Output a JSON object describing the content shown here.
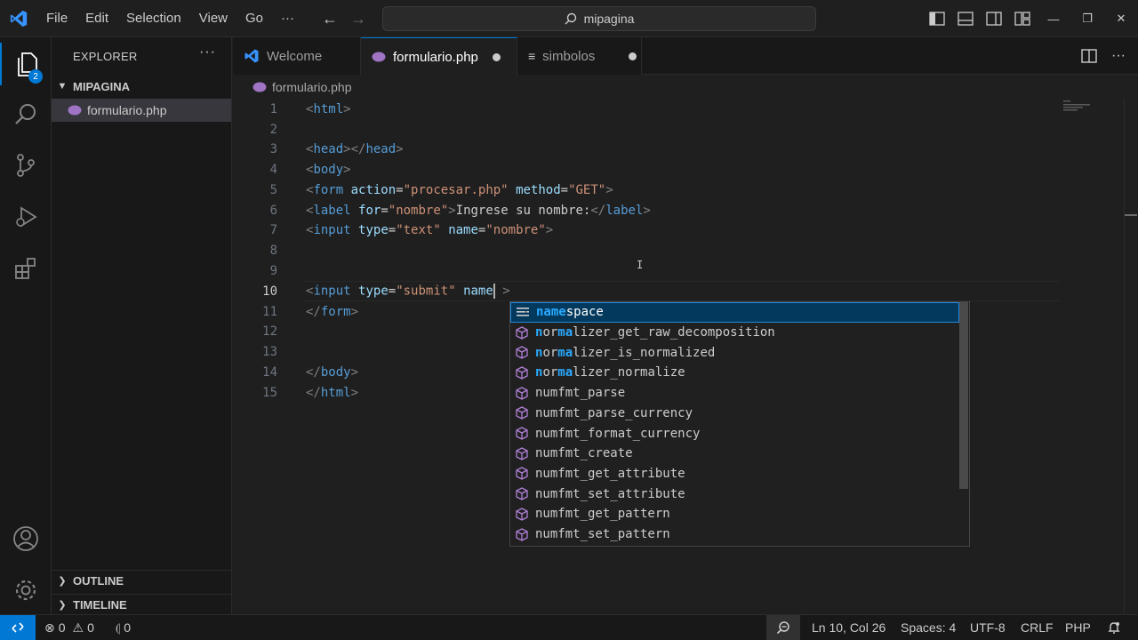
{
  "titlebar": {
    "menu": [
      "File",
      "Edit",
      "Selection",
      "View",
      "Go",
      "···"
    ],
    "search_text": "mipagina"
  },
  "activity": {
    "explorer_badge": "2"
  },
  "sidebar": {
    "title": "EXPLORER",
    "more": "···",
    "folder": "MIPAGINA",
    "files": [
      "formulario.php"
    ],
    "outline": "OUTLINE",
    "timeline": "TIMELINE"
  },
  "tabs": [
    {
      "label": "Welcome"
    },
    {
      "label": "formulario.php"
    },
    {
      "label": "simbolos"
    }
  ],
  "breadcrumb": "formulario.php",
  "editor": {
    "lines": [
      {
        "n": "1"
      },
      {
        "n": "2"
      },
      {
        "n": "3"
      },
      {
        "n": "4"
      },
      {
        "n": "5"
      },
      {
        "n": "6"
      },
      {
        "n": "7"
      },
      {
        "n": "8"
      },
      {
        "n": "9"
      },
      {
        "n": "10"
      },
      {
        "n": "11"
      },
      {
        "n": "12"
      },
      {
        "n": "13"
      },
      {
        "n": "14"
      },
      {
        "n": "15"
      }
    ]
  },
  "suggest": [
    {
      "pre": "",
      "hl": "name",
      "post": "space"
    },
    {
      "pre": "",
      "hl": "n",
      "post": "or",
      "hl2": "ma",
      "post2": "lizer_get_raw_decomposition"
    },
    {
      "pre": "",
      "hl": "n",
      "post": "or",
      "hl2": "ma",
      "post2": "lizer_is_normalized"
    },
    {
      "pre": "",
      "hl": "n",
      "post": "or",
      "hl2": "ma",
      "post2": "lizer_normalize"
    },
    {
      "text": "numfmt_parse"
    },
    {
      "text": "numfmt_parse_currency"
    },
    {
      "text": "numfmt_format_currency"
    },
    {
      "text": "numfmt_create"
    },
    {
      "text": "numfmt_get_attribute"
    },
    {
      "text": "numfmt_set_attribute"
    },
    {
      "text": "numfmt_get_pattern"
    },
    {
      "text": "numfmt_set_pattern"
    }
  ],
  "statusbar": {
    "errors": "0",
    "warnings": "0",
    "ports": "0",
    "position": "Ln 10, Col 26",
    "spaces": "Spaces: 4",
    "encoding": "UTF-8",
    "eol": "CRLF",
    "language": "PHP"
  },
  "colors": {
    "accent": "#0078d4",
    "php_icon": "#a074c4",
    "vscode_blue": "#3794ff"
  }
}
